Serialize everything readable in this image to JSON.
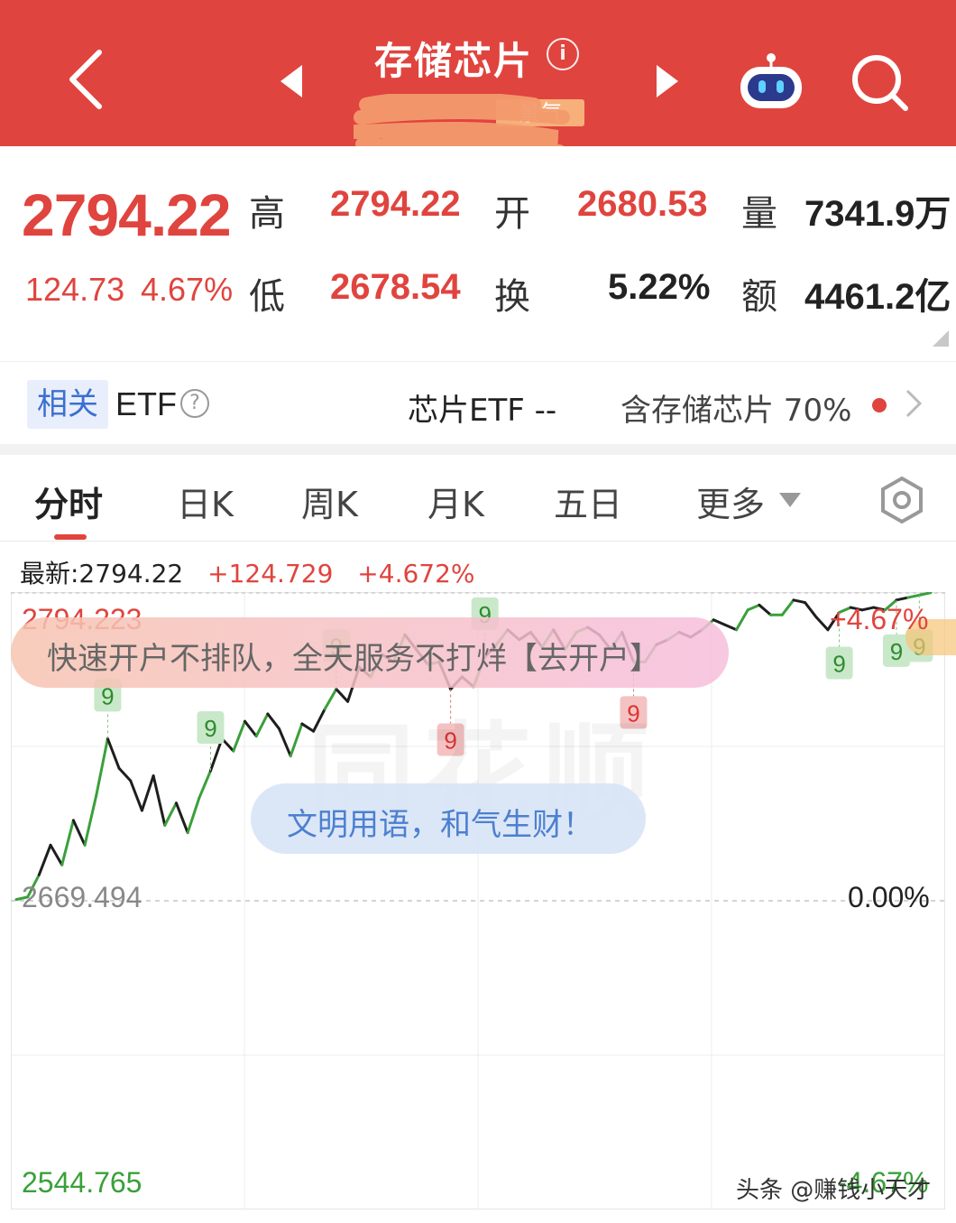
{
  "header": {
    "title": "存储芯片",
    "subtitle_tag": "景气",
    "colors": {
      "bar": "#e0443e",
      "text": "#ffffff"
    }
  },
  "quote": {
    "price": "2794.22",
    "change": "124.73",
    "change_pct": "4.67%",
    "high_label": "高",
    "high": "2794.22",
    "low_label": "低",
    "low": "2678.54",
    "open_label": "开",
    "open": "2680.53",
    "turnover_label": "换",
    "turnover": "5.22%",
    "volume_label": "量",
    "volume": "7341.9万",
    "amount_label": "额",
    "amount": "4461.2亿"
  },
  "etf": {
    "tag": "相关",
    "label": "ETF",
    "help_glyph": "?",
    "name": "芯片ETF",
    "value": "--",
    "relation": "含存储芯片 70%"
  },
  "tabs": [
    {
      "label": "分时",
      "active": true
    },
    {
      "label": "日K"
    },
    {
      "label": "周K"
    },
    {
      "label": "月K"
    },
    {
      "label": "五日"
    },
    {
      "label": "更多"
    }
  ],
  "info_row": {
    "latest": "最新:2794.22",
    "change": "+124.729",
    "change_pct": "+4.672%"
  },
  "chart": {
    "y_max_label": "2794.223",
    "y_mid_label": "2669.494",
    "y_min_label": "2544.765",
    "pct_top_label": "+4.67%",
    "pct_mid_label": "0.00%",
    "pct_bottom_label": "-4.67%",
    "signal_digit": "9",
    "watermark": "同花顺",
    "banner_ad": "快速开户不排队，全天服务不打烊【去开户】",
    "banner_notice": "文明用语，和气生财！",
    "credit": "头条 @赚钱小天才"
  },
  "chart_data": {
    "type": "line",
    "title": "",
    "xlabel": "",
    "ylabel": "",
    "ylim": [
      2544.765,
      2794.223
    ],
    "reference": 2669.494,
    "grid": true,
    "x": [
      0,
      1,
      2,
      3,
      4,
      5,
      6,
      7,
      8,
      9,
      10,
      11,
      12,
      13,
      14,
      15,
      16,
      17,
      18,
      19,
      20,
      21,
      22,
      23,
      24,
      25,
      26,
      27,
      28,
      29,
      30,
      31,
      32,
      33,
      34,
      35,
      36,
      37,
      38,
      39,
      40,
      41,
      42,
      43,
      44,
      45,
      46,
      47,
      48,
      49,
      50,
      51,
      52,
      53,
      54,
      55,
      56,
      57,
      58,
      59,
      60,
      61,
      62,
      63,
      64,
      65,
      66,
      67,
      68,
      69,
      70,
      71,
      72,
      73,
      74,
      75,
      76,
      77,
      78,
      79,
      80
    ],
    "series": [
      {
        "values": [
          2670.0,
          2671.0,
          2680.0,
          2692.0,
          2684.0,
          2702.0,
          2692.0,
          2712.0,
          2735.0,
          2723.0,
          2718.0,
          2706.0,
          2720.0,
          2700.0,
          2709.0,
          2697.0,
          2711.0,
          2722.0,
          2735.0,
          2730.0,
          2742.0,
          2736.0,
          2745.0,
          2739.0,
          2728.0,
          2741.0,
          2738.0,
          2747.0,
          2755.0,
          2750.0,
          2764.0,
          2760.0,
          2769.0,
          2766.0,
          2777.0,
          2771.0,
          2765.0,
          2766.0,
          2755.0,
          2760.0,
          2756.0,
          2768.0,
          2773.0,
          2779.0,
          2775.0,
          2778.0,
          2772.0,
          2779.0,
          2771.0,
          2778.0,
          2780.0,
          2777.0,
          2771.0,
          2778.0,
          2766.0,
          2766.0,
          2773.0,
          2775.0,
          2778.0,
          2776.0,
          2779.0,
          2783.0,
          2781.0,
          2779.0,
          2787.0,
          2789.0,
          2785.0,
          2785.0,
          2791.0,
          2790.0,
          2784.0,
          2779.0,
          2786.0,
          2788.0,
          2787.0,
          2788.0,
          2787.0,
          2791.0,
          2792.0,
          2793.0,
          2794.0
        ]
      }
    ]
  }
}
